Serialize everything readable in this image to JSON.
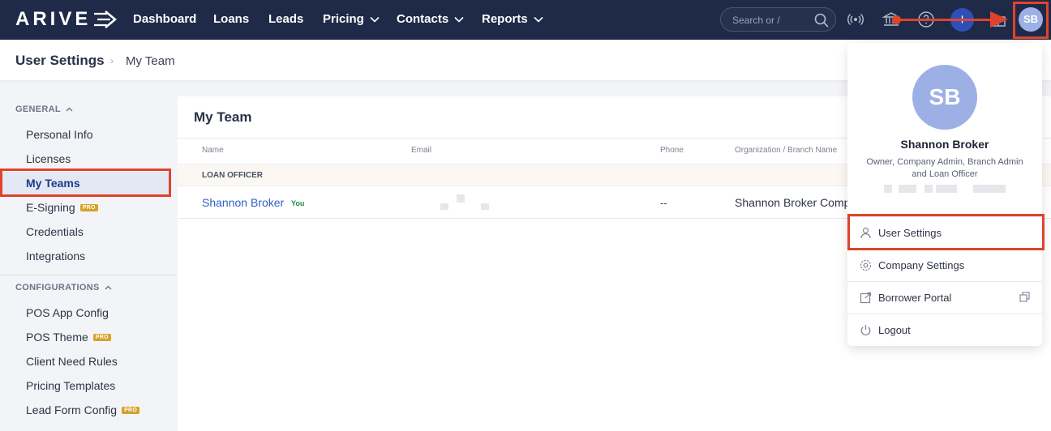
{
  "brand": {
    "logo_text": "ARIVE"
  },
  "nav": {
    "items": [
      {
        "label": "Dashboard",
        "has_dropdown": false
      },
      {
        "label": "Loans",
        "has_dropdown": false
      },
      {
        "label": "Leads",
        "has_dropdown": false
      },
      {
        "label": "Pricing",
        "has_dropdown": true
      },
      {
        "label": "Contacts",
        "has_dropdown": true
      },
      {
        "label": "Reports",
        "has_dropdown": true
      }
    ],
    "search_placeholder": "Search or /",
    "plus_label": "+",
    "avatar_initials": "SB"
  },
  "breadcrumb": {
    "parent": "User Settings",
    "separator": "›",
    "current": "My Team"
  },
  "sidebar": {
    "general_heading": "GENERAL",
    "general_items": [
      {
        "label": "Personal Info",
        "pro": false,
        "active": false
      },
      {
        "label": "Licenses",
        "pro": false,
        "active": false
      },
      {
        "label": "My Teams",
        "pro": false,
        "active": true
      },
      {
        "label": "E-Signing",
        "pro": true,
        "active": false
      },
      {
        "label": "Credentials",
        "pro": false,
        "active": false
      },
      {
        "label": "Integrations",
        "pro": false,
        "active": false
      }
    ],
    "config_heading": "CONFIGURATIONS",
    "config_items": [
      {
        "label": "POS App Config",
        "pro": false
      },
      {
        "label": "POS Theme",
        "pro": true
      },
      {
        "label": "Client Need Rules",
        "pro": false
      },
      {
        "label": "Pricing Templates",
        "pro": false
      },
      {
        "label": "Lead Form Config",
        "pro": true
      }
    ],
    "pro_badge": "PRO"
  },
  "main": {
    "title": "My Team",
    "columns": [
      "Name",
      "Email",
      "Phone",
      "Organization / Branch Name"
    ],
    "group_label": "LOAN OFFICER",
    "rows": [
      {
        "name": "Shannon Broker",
        "you_tag": "You",
        "phone": "--",
        "org": "Shannon Broker Comp"
      }
    ]
  },
  "profile_menu": {
    "initials": "SB",
    "name": "Shannon Broker",
    "role": "Owner, Company Admin, Branch Admin and Loan Officer",
    "items": [
      {
        "label": "User Settings",
        "icon": "user-icon"
      },
      {
        "label": "Company Settings",
        "icon": "gear-icon"
      },
      {
        "label": "Borrower Portal",
        "icon": "external-link-icon"
      },
      {
        "label": "Logout",
        "icon": "power-icon"
      }
    ]
  },
  "colors": {
    "nav_bg": "#1f2a48",
    "highlight": "#e0432b",
    "avatar": "#9db0e6",
    "link": "#2f5fc4",
    "pro_badge": "#d4a22b"
  }
}
